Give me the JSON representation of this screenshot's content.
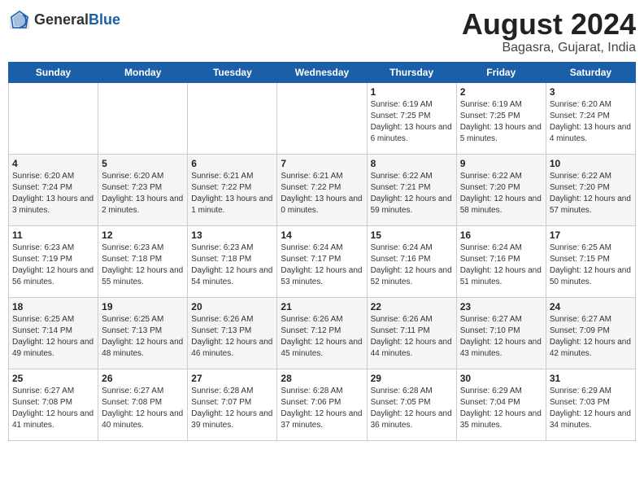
{
  "header": {
    "logo_general": "General",
    "logo_blue": "Blue",
    "title": "August 2024",
    "location": "Bagasra, Gujarat, India"
  },
  "calendar": {
    "weekdays": [
      "Sunday",
      "Monday",
      "Tuesday",
      "Wednesday",
      "Thursday",
      "Friday",
      "Saturday"
    ],
    "weeks": [
      [
        {
          "day": "",
          "info": ""
        },
        {
          "day": "",
          "info": ""
        },
        {
          "day": "",
          "info": ""
        },
        {
          "day": "",
          "info": ""
        },
        {
          "day": "1",
          "info": "Sunrise: 6:19 AM\nSunset: 7:25 PM\nDaylight: 13 hours and 6 minutes."
        },
        {
          "day": "2",
          "info": "Sunrise: 6:19 AM\nSunset: 7:25 PM\nDaylight: 13 hours and 5 minutes."
        },
        {
          "day": "3",
          "info": "Sunrise: 6:20 AM\nSunset: 7:24 PM\nDaylight: 13 hours and 4 minutes."
        }
      ],
      [
        {
          "day": "4",
          "info": "Sunrise: 6:20 AM\nSunset: 7:24 PM\nDaylight: 13 hours and 3 minutes."
        },
        {
          "day": "5",
          "info": "Sunrise: 6:20 AM\nSunset: 7:23 PM\nDaylight: 13 hours and 2 minutes."
        },
        {
          "day": "6",
          "info": "Sunrise: 6:21 AM\nSunset: 7:22 PM\nDaylight: 13 hours and 1 minute."
        },
        {
          "day": "7",
          "info": "Sunrise: 6:21 AM\nSunset: 7:22 PM\nDaylight: 13 hours and 0 minutes."
        },
        {
          "day": "8",
          "info": "Sunrise: 6:22 AM\nSunset: 7:21 PM\nDaylight: 12 hours and 59 minutes."
        },
        {
          "day": "9",
          "info": "Sunrise: 6:22 AM\nSunset: 7:20 PM\nDaylight: 12 hours and 58 minutes."
        },
        {
          "day": "10",
          "info": "Sunrise: 6:22 AM\nSunset: 7:20 PM\nDaylight: 12 hours and 57 minutes."
        }
      ],
      [
        {
          "day": "11",
          "info": "Sunrise: 6:23 AM\nSunset: 7:19 PM\nDaylight: 12 hours and 56 minutes."
        },
        {
          "day": "12",
          "info": "Sunrise: 6:23 AM\nSunset: 7:18 PM\nDaylight: 12 hours and 55 minutes."
        },
        {
          "day": "13",
          "info": "Sunrise: 6:23 AM\nSunset: 7:18 PM\nDaylight: 12 hours and 54 minutes."
        },
        {
          "day": "14",
          "info": "Sunrise: 6:24 AM\nSunset: 7:17 PM\nDaylight: 12 hours and 53 minutes."
        },
        {
          "day": "15",
          "info": "Sunrise: 6:24 AM\nSunset: 7:16 PM\nDaylight: 12 hours and 52 minutes."
        },
        {
          "day": "16",
          "info": "Sunrise: 6:24 AM\nSunset: 7:16 PM\nDaylight: 12 hours and 51 minutes."
        },
        {
          "day": "17",
          "info": "Sunrise: 6:25 AM\nSunset: 7:15 PM\nDaylight: 12 hours and 50 minutes."
        }
      ],
      [
        {
          "day": "18",
          "info": "Sunrise: 6:25 AM\nSunset: 7:14 PM\nDaylight: 12 hours and 49 minutes."
        },
        {
          "day": "19",
          "info": "Sunrise: 6:25 AM\nSunset: 7:13 PM\nDaylight: 12 hours and 48 minutes."
        },
        {
          "day": "20",
          "info": "Sunrise: 6:26 AM\nSunset: 7:13 PM\nDaylight: 12 hours and 46 minutes."
        },
        {
          "day": "21",
          "info": "Sunrise: 6:26 AM\nSunset: 7:12 PM\nDaylight: 12 hours and 45 minutes."
        },
        {
          "day": "22",
          "info": "Sunrise: 6:26 AM\nSunset: 7:11 PM\nDaylight: 12 hours and 44 minutes."
        },
        {
          "day": "23",
          "info": "Sunrise: 6:27 AM\nSunset: 7:10 PM\nDaylight: 12 hours and 43 minutes."
        },
        {
          "day": "24",
          "info": "Sunrise: 6:27 AM\nSunset: 7:09 PM\nDaylight: 12 hours and 42 minutes."
        }
      ],
      [
        {
          "day": "25",
          "info": "Sunrise: 6:27 AM\nSunset: 7:08 PM\nDaylight: 12 hours and 41 minutes."
        },
        {
          "day": "26",
          "info": "Sunrise: 6:27 AM\nSunset: 7:08 PM\nDaylight: 12 hours and 40 minutes."
        },
        {
          "day": "27",
          "info": "Sunrise: 6:28 AM\nSunset: 7:07 PM\nDaylight: 12 hours and 39 minutes."
        },
        {
          "day": "28",
          "info": "Sunrise: 6:28 AM\nSunset: 7:06 PM\nDaylight: 12 hours and 37 minutes."
        },
        {
          "day": "29",
          "info": "Sunrise: 6:28 AM\nSunset: 7:05 PM\nDaylight: 12 hours and 36 minutes."
        },
        {
          "day": "30",
          "info": "Sunrise: 6:29 AM\nSunset: 7:04 PM\nDaylight: 12 hours and 35 minutes."
        },
        {
          "day": "31",
          "info": "Sunrise: 6:29 AM\nSunset: 7:03 PM\nDaylight: 12 hours and 34 minutes."
        }
      ]
    ]
  }
}
